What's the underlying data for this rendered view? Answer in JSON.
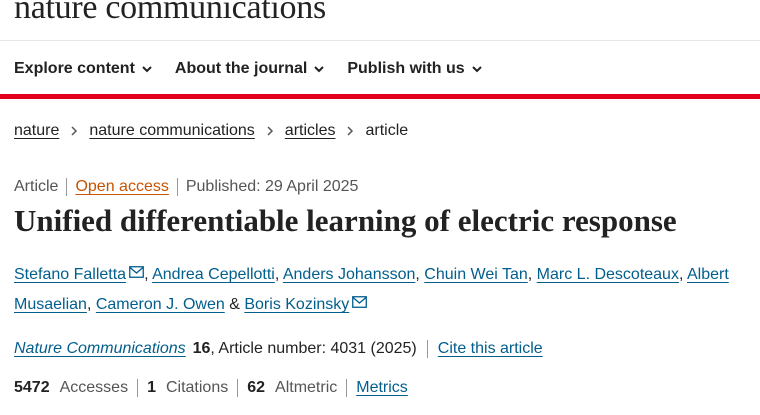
{
  "header": {
    "brand": "nature communications",
    "nav": [
      {
        "label": "Explore content"
      },
      {
        "label": "About the journal"
      },
      {
        "label": "Publish with us"
      }
    ]
  },
  "breadcrumb": {
    "items": [
      "nature",
      "nature communications",
      "articles"
    ],
    "current": "article"
  },
  "meta": {
    "type": "Article",
    "access": "Open access",
    "published": "Published: 29 April 2025"
  },
  "title": "Unified differentiable learning of electric response",
  "authors": [
    {
      "name": "Stefano Falletta",
      "email_icon": "mail-icon"
    },
    {
      "name": "Andrea Cepellotti"
    },
    {
      "name": "Anders Johansson"
    },
    {
      "name": "Chuin Wei Tan"
    },
    {
      "name": "Marc L. Descoteaux"
    },
    {
      "name": "Albert Musaelian"
    },
    {
      "name": "Cameron J. Owen"
    },
    {
      "name": "Boris Kozinsky",
      "email_icon": "mail-icon"
    }
  ],
  "author_separators": {
    "comma": ",",
    "amp": "&"
  },
  "citation": {
    "journal": "Nature Communications",
    "volume": "16",
    "article_number": ", Article number: 4031 (2025)",
    "cite_label": "Cite this article"
  },
  "metrics": {
    "accesses_count": "5472",
    "accesses_label": "Accesses",
    "citations_count": "1",
    "citations_label": "Citations",
    "altmetric_count": "62",
    "altmetric_label": "Altmetric",
    "metrics_link": "Metrics"
  },
  "colors": {
    "accent_red": "#e2001a",
    "link_blue": "#025e8d",
    "open_access_orange": "#c65301"
  }
}
